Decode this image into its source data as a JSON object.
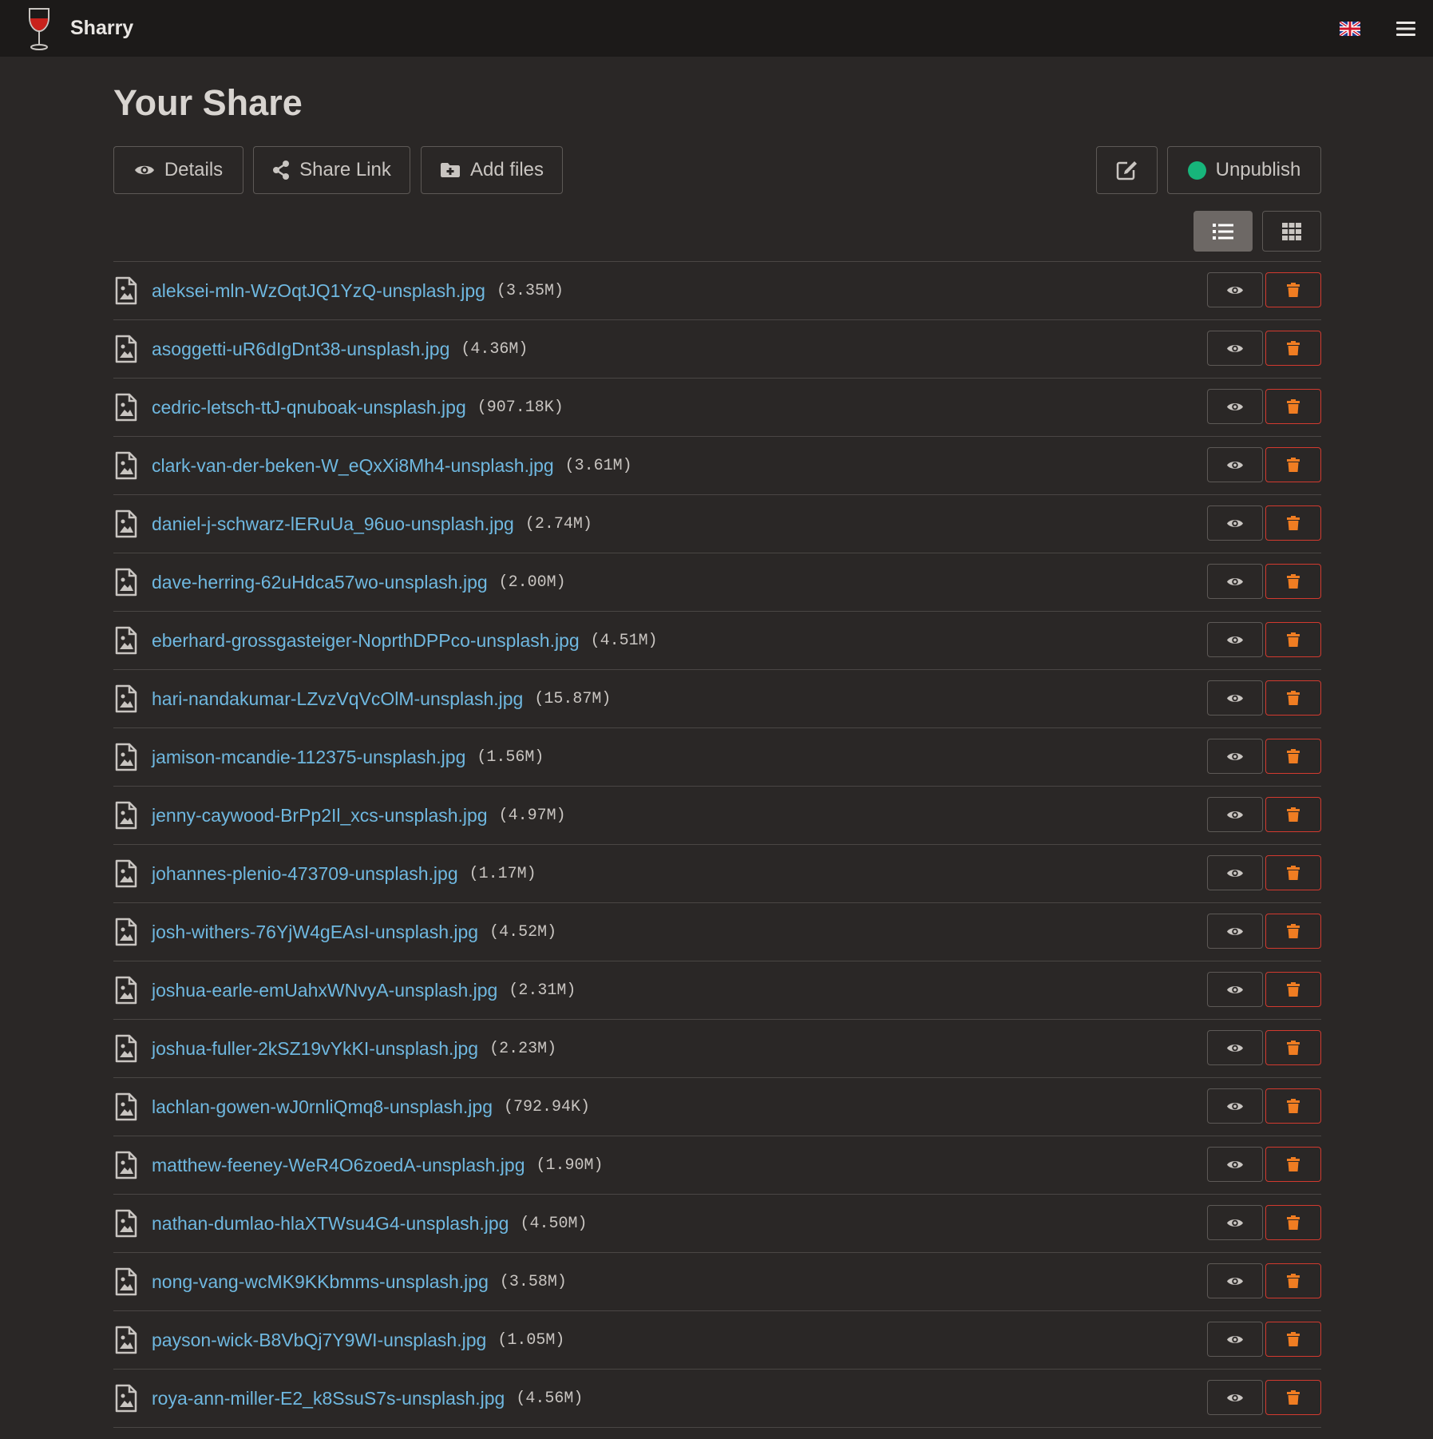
{
  "app": {
    "name": "Sharry",
    "language_flag": "flag-uk-icon"
  },
  "page": {
    "title": "Your Share"
  },
  "toolbar": {
    "details_label": "Details",
    "share_link_label": "Share Link",
    "add_files_label": "Add files",
    "unpublish_label": "Unpublish",
    "published_status_color": "#17b57b"
  },
  "view_mode": {
    "selected": "list",
    "options": [
      "list",
      "grid"
    ]
  },
  "colors": {
    "link": "#6fb8e0",
    "delete_border": "#d23a2f",
    "delete_icon": "#f07d22"
  },
  "files": [
    {
      "name": "aleksei-mln-WzOqtJQ1YzQ-unsplash.jpg",
      "size": "(3.35M)"
    },
    {
      "name": "asoggetti-uR6dIgDnt38-unsplash.jpg",
      "size": "(4.36M)"
    },
    {
      "name": "cedric-letsch-ttJ-qnuboak-unsplash.jpg",
      "size": "(907.18K)"
    },
    {
      "name": "clark-van-der-beken-W_eQxXi8Mh4-unsplash.jpg",
      "size": "(3.61M)"
    },
    {
      "name": "daniel-j-schwarz-lERuUa_96uo-unsplash.jpg",
      "size": "(2.74M)"
    },
    {
      "name": "dave-herring-62uHdca57wo-unsplash.jpg",
      "size": "(2.00M)"
    },
    {
      "name": "eberhard-grossgasteiger-NoprthDPPco-unsplash.jpg",
      "size": "(4.51M)"
    },
    {
      "name": "hari-nandakumar-LZvzVqVcOlM-unsplash.jpg",
      "size": "(15.87M)"
    },
    {
      "name": "jamison-mcandie-112375-unsplash.jpg",
      "size": "(1.56M)"
    },
    {
      "name": "jenny-caywood-BrPp2Il_xcs-unsplash.jpg",
      "size": "(4.97M)"
    },
    {
      "name": "johannes-plenio-473709-unsplash.jpg",
      "size": "(1.17M)"
    },
    {
      "name": "josh-withers-76YjW4gEAsI-unsplash.jpg",
      "size": "(4.52M)"
    },
    {
      "name": "joshua-earle-emUahxWNvyA-unsplash.jpg",
      "size": "(2.31M)"
    },
    {
      "name": "joshua-fuller-2kSZ19vYkKI-unsplash.jpg",
      "size": "(2.23M)"
    },
    {
      "name": "lachlan-gowen-wJ0rnliQmq8-unsplash.jpg",
      "size": "(792.94K)"
    },
    {
      "name": "matthew-feeney-WeR4O6zoedA-unsplash.jpg",
      "size": "(1.90M)"
    },
    {
      "name": "nathan-dumlao-hlaXTWsu4G4-unsplash.jpg",
      "size": "(4.50M)"
    },
    {
      "name": "nong-vang-wcMK9KKbmms-unsplash.jpg",
      "size": "(3.58M)"
    },
    {
      "name": "payson-wick-B8VbQj7Y9WI-unsplash.jpg",
      "size": "(1.05M)"
    },
    {
      "name": "roya-ann-miller-E2_k8SsuS7s-unsplash.jpg",
      "size": "(4.56M)"
    }
  ]
}
